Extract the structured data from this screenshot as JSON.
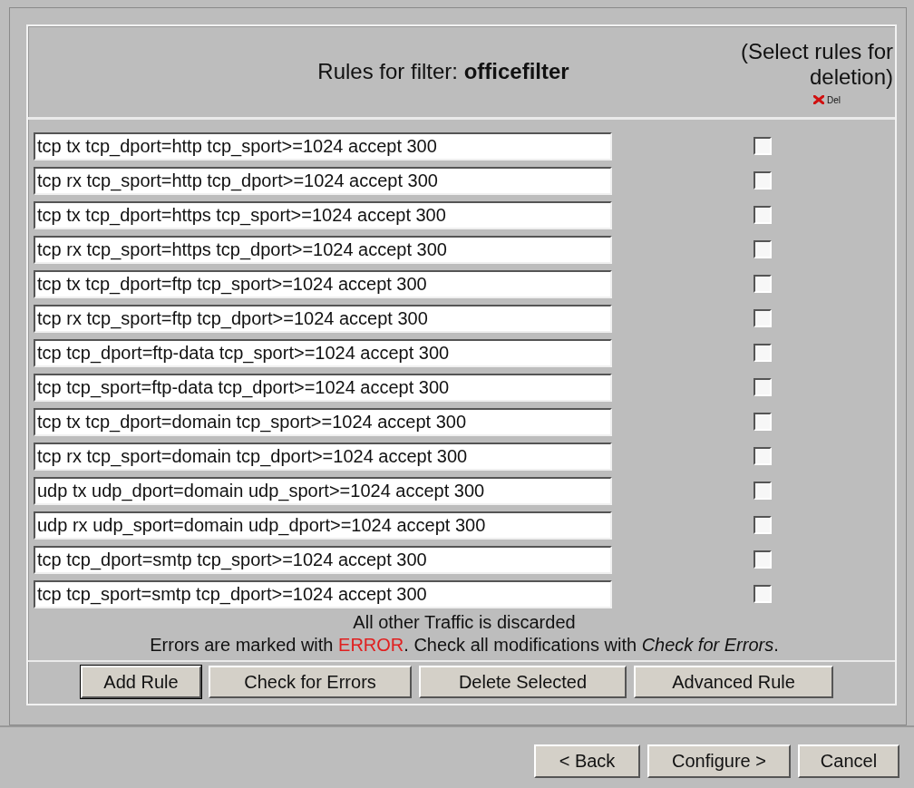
{
  "header": {
    "title": "Rules for filter: **officefilter**",
    "select_hint": "(Select rules for deletion)",
    "del_label": "Del"
  },
  "rules": [
    {
      "value": "tcp tx tcp_dport=http tcp_sport>=1024 accept 300",
      "checked": false
    },
    {
      "value": "tcp rx tcp_sport=http tcp_dport>=1024 accept 300",
      "checked": false
    },
    {
      "value": "tcp tx tcp_dport=https tcp_sport>=1024 accept 300",
      "checked": false
    },
    {
      "value": "tcp rx tcp_sport=https tcp_dport>=1024 accept 300",
      "checked": false
    },
    {
      "value": "tcp tx tcp_dport=ftp tcp_sport>=1024 accept 300",
      "checked": false
    },
    {
      "value": "tcp rx tcp_sport=ftp tcp_dport>=1024 accept 300",
      "checked": false
    },
    {
      "value": "tcp tcp_dport=ftp-data tcp_sport>=1024 accept 300",
      "checked": false
    },
    {
      "value": "tcp tcp_sport=ftp-data tcp_dport>=1024 accept 300",
      "checked": false
    },
    {
      "value": "tcp tx tcp_dport=domain tcp_sport>=1024 accept 300",
      "checked": false
    },
    {
      "value": "tcp rx tcp_sport=domain tcp_dport>=1024 accept 300",
      "checked": false
    },
    {
      "value": "udp tx udp_dport=domain udp_sport>=1024 accept 300",
      "checked": false
    },
    {
      "value": "udp rx udp_sport=domain udp_dport>=1024 accept 300",
      "checked": false
    },
    {
      "value": "tcp tcp_dport=smtp tcp_sport>=1024 accept 300",
      "checked": false
    },
    {
      "value": "tcp tcp_sport=smtp tcp_dport>=1024 accept 300",
      "checked": false
    }
  ],
  "notice": "All other Traffic is discarded",
  "errors_note": [
    {
      "kind": "plain",
      "text": "Errors are marked with "
    },
    {
      "kind": "error",
      "text": "ERROR"
    },
    {
      "kind": "plain",
      "text": ". Check all modifications with "
    },
    {
      "kind": "em",
      "text": "Check for Errors"
    },
    {
      "kind": "plain",
      "text": "."
    }
  ],
  "rule_buttons": [
    {
      "label": "Add Rule",
      "default": true
    },
    {
      "label": "Check for Errors",
      "default": false
    },
    {
      "label": "Delete Selected",
      "default": false
    },
    {
      "label": "Advanced Rule",
      "default": false
    }
  ],
  "nav_buttons": [
    "< Back",
    "Configure >",
    "Cancel"
  ]
}
